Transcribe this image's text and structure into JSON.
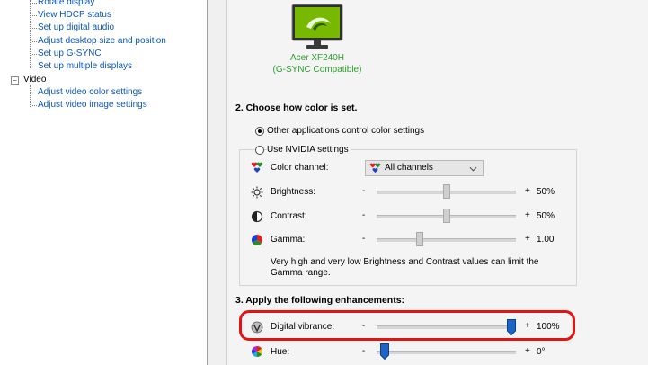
{
  "tree": {
    "links": [
      {
        "label": "Rotate display"
      },
      {
        "label": "View HDCP status"
      },
      {
        "label": "Set up digital audio"
      },
      {
        "label": "Adjust desktop size and position"
      },
      {
        "label": "Set up G-SYNC"
      },
      {
        "label": "Set up multiple displays"
      }
    ],
    "video_category": "Video",
    "video_links": [
      {
        "label": "Adjust video color settings"
      },
      {
        "label": "Adjust video image settings"
      }
    ]
  },
  "display": {
    "name": "Acer XF240H",
    "subtitle": "(G-SYNC Compatible)"
  },
  "section2": {
    "heading": "2. Choose how color is set.",
    "option_other": "Other applications control color settings",
    "option_nvidia": "Use NVIDIA settings",
    "selected": "other",
    "color_channel_label": "Color channel:",
    "color_channel_value": "All channels",
    "brightness": {
      "label": "Brightness:",
      "minus": "-",
      "plus": "+",
      "value": "50%",
      "fraction": 0.5
    },
    "contrast": {
      "label": "Contrast:",
      "minus": "-",
      "plus": "+",
      "value": "50%",
      "fraction": 0.5
    },
    "gamma": {
      "label": "Gamma:",
      "minus": "-",
      "plus": "+",
      "value": "1.00",
      "fraction": 0.3
    },
    "note": "Very high and very low Brightness and Contrast values can limit the Gamma range."
  },
  "section3": {
    "heading": "3. Apply the following enhancements:",
    "vibrance": {
      "label": "Digital vibrance:",
      "minus": "-",
      "plus": "+",
      "value": "100%",
      "fraction": 1.0
    },
    "hue": {
      "label": "Hue:",
      "minus": "-",
      "plus": "+",
      "value": "0°",
      "fraction": 0.03
    }
  },
  "colors": {
    "link": "#0b56b7",
    "accent_green": "#2ca02c",
    "nvidia_green": "#76b900",
    "highlight_red": "#e11313",
    "slider_blue": "#1c64c8"
  },
  "icons": {
    "color_channel": "rgb-hearts-icon",
    "brightness": "sun-icon",
    "contrast": "contrast-icon",
    "gamma": "gamma-icon",
    "vibrance": "vibrance-icon",
    "hue": "hue-wheel-icon"
  }
}
